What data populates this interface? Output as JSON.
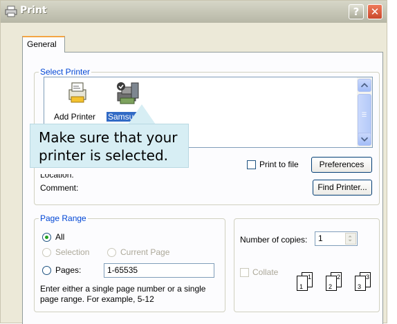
{
  "window": {
    "title": "Print",
    "help_glyph": "?",
    "close_glyph": "✕"
  },
  "tabs": [
    {
      "label": "General"
    }
  ],
  "select_printer": {
    "group_title": "Select Printer",
    "printers": [
      {
        "label": "Add Printer",
        "selected": false
      },
      {
        "label": "Samsung",
        "selected": true
      }
    ],
    "location_label": "Location:",
    "comment_label": "Comment:",
    "print_to_file_label": "Print to file",
    "print_to_file_checked": false,
    "preferences_label": "Preferences",
    "find_printer_label": "Find Printer..."
  },
  "callout": {
    "line1": "Make sure that your",
    "line2": "printer is selected."
  },
  "page_range": {
    "group_title": "Page Range",
    "options": {
      "all": "All",
      "selection": "Selection",
      "current_page": "Current Page",
      "pages": "Pages:"
    },
    "selected": "all",
    "pages_value": "1-65535",
    "hint_line1": "Enter either a single page number or a single",
    "hint_line2": "page range.  For example, 5-12"
  },
  "copies": {
    "label": "Number of copies:",
    "value": "1",
    "collate_label": "Collate",
    "collate_checked": false,
    "collate_pages": [
      "1",
      "1",
      "2",
      "2",
      "3",
      "3"
    ]
  },
  "colors": {
    "accent": "#316ac5",
    "group_title": "#0046d5",
    "callout_bg": "#d7eef4"
  }
}
